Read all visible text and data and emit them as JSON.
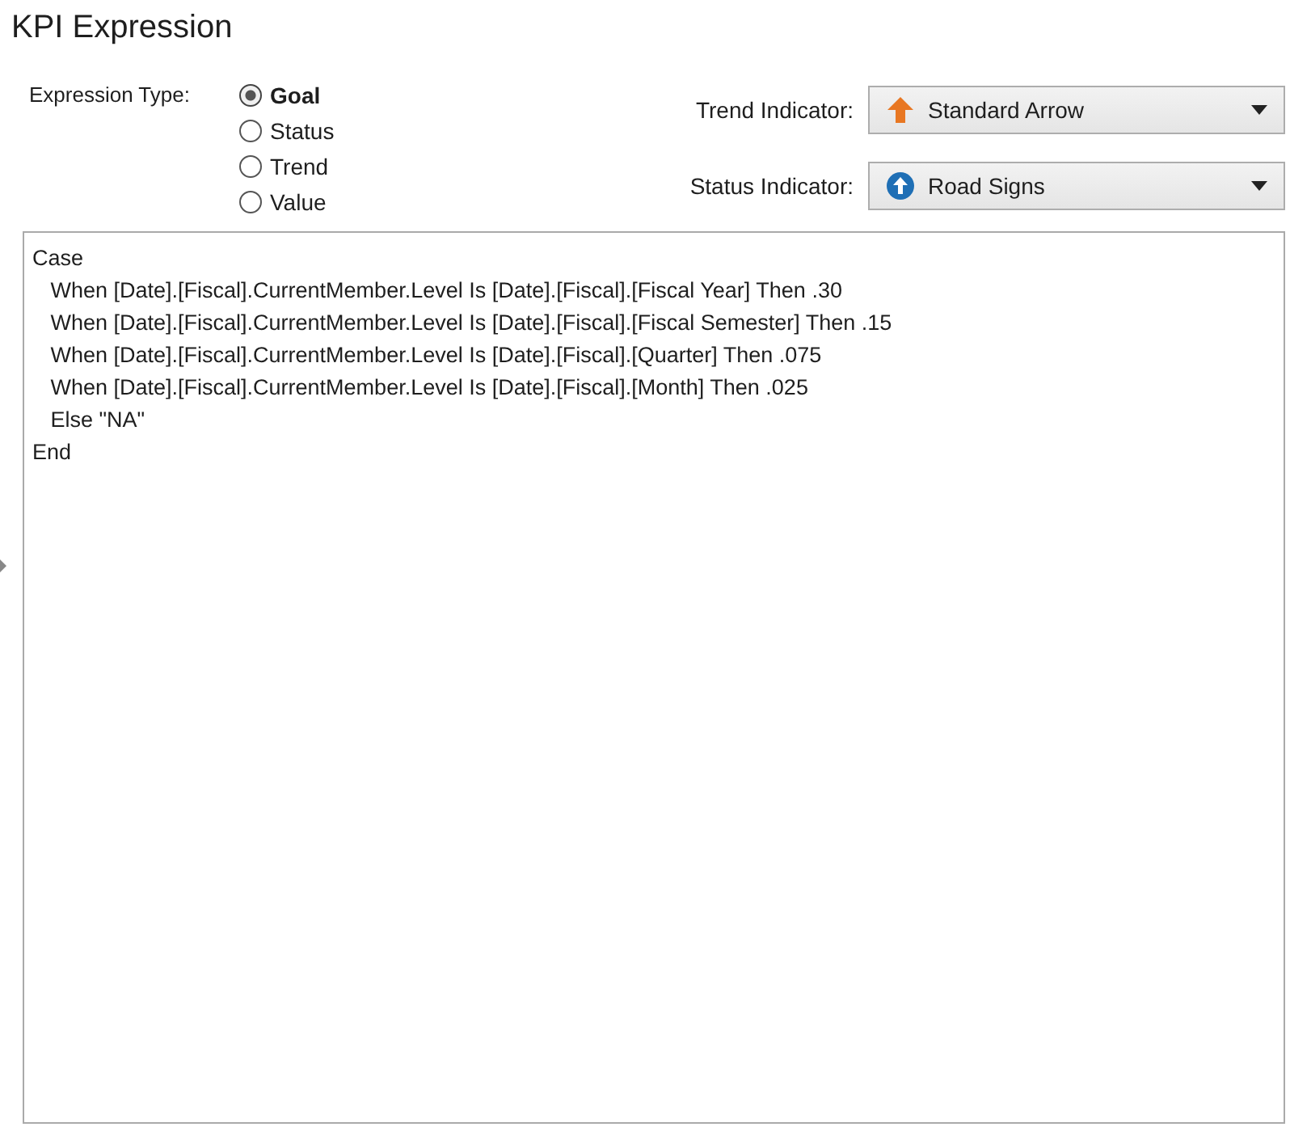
{
  "title": "KPI Expression",
  "expression_type": {
    "label": "Expression Type:",
    "options": [
      {
        "label": "Goal",
        "selected": true
      },
      {
        "label": "Status",
        "selected": false
      },
      {
        "label": "Trend",
        "selected": false
      },
      {
        "label": "Value",
        "selected": false
      }
    ]
  },
  "indicators": [
    {
      "label": "Trend Indicator:",
      "value": "Standard Arrow",
      "kind": "arrow"
    },
    {
      "label": "Status Indicator:",
      "value": "Road Signs",
      "kind": "road-sign"
    }
  ],
  "code_lines": [
    "Case",
    "   When [Date].[Fiscal].CurrentMember.Level Is [Date].[Fiscal].[Fiscal Year] Then .30",
    "   When [Date].[Fiscal].CurrentMember.Level Is [Date].[Fiscal].[Fiscal Semester] Then .15",
    "   When [Date].[Fiscal].CurrentMember.Level Is [Date].[Fiscal].[Quarter] Then .075",
    "   When [Date].[Fiscal].CurrentMember.Level Is [Date].[Fiscal].[Month] Then .025",
    "   Else \"NA\"",
    "End"
  ]
}
